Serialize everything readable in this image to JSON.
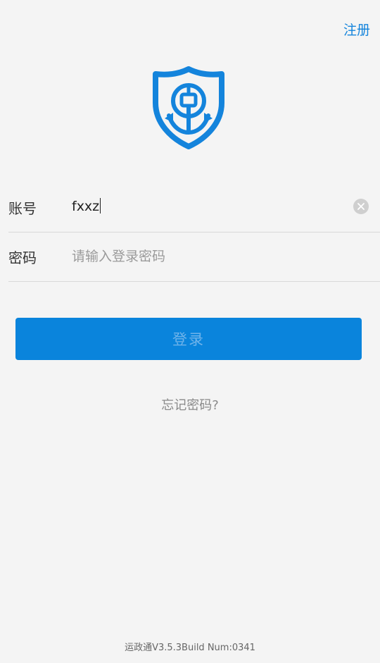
{
  "header": {
    "register_label": "注册"
  },
  "logo": {
    "icon": "shield-anchor-logo",
    "color": "#1484dc"
  },
  "form": {
    "account": {
      "label": "账号",
      "value": "fxxz"
    },
    "password": {
      "label": "密码",
      "placeholder": "请输入登录密码",
      "value": ""
    }
  },
  "login_button": {
    "label": "登录",
    "background": "#0a84dc"
  },
  "forgot_password_label": "忘记密码?",
  "footer": {
    "version_text": "运政通V3.5.3Build Num:0341"
  }
}
